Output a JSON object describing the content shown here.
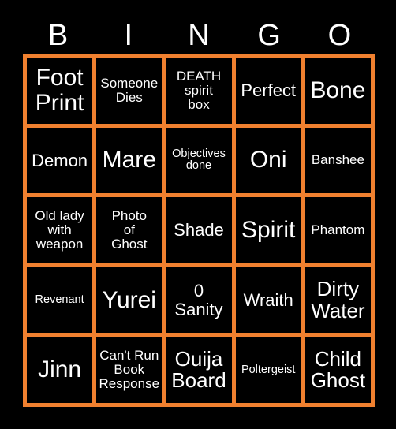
{
  "card": {
    "title": "BINGO",
    "header_letters": [
      "B",
      "I",
      "N",
      "G",
      "O"
    ],
    "colors": {
      "background": "#000000",
      "grid_border": "#F0802F",
      "cell_background": "#000000",
      "text": "#FFFFFF"
    },
    "grid": {
      "columns": 5,
      "rows": 5,
      "cells": [
        {
          "text": "Foot\nPrint",
          "size": "fs-xl",
          "marked": false
        },
        {
          "text": "Someone\nDies",
          "size": "fs-sm",
          "marked": false
        },
        {
          "text": "DEATH\nspirit\nbox",
          "size": "fs-sm",
          "marked": false
        },
        {
          "text": "Perfect",
          "size": "fs-md",
          "marked": false
        },
        {
          "text": "Bone",
          "size": "fs-xl",
          "marked": false
        },
        {
          "text": "Demon",
          "size": "fs-md",
          "marked": false
        },
        {
          "text": "Mare",
          "size": "fs-xl",
          "marked": false
        },
        {
          "text": "Objectives\ndone",
          "size": "fs-xs",
          "marked": false
        },
        {
          "text": "Oni",
          "size": "fs-xl",
          "marked": false
        },
        {
          "text": "Banshee",
          "size": "fs-sm",
          "marked": false
        },
        {
          "text": "Old lady\nwith\nweapon",
          "size": "fs-sm",
          "marked": false
        },
        {
          "text": "Photo\nof\nGhost",
          "size": "fs-sm",
          "marked": false
        },
        {
          "text": "Shade",
          "size": "fs-md",
          "marked": false
        },
        {
          "text": "Spirit",
          "size": "fs-xl",
          "marked": false
        },
        {
          "text": "Phantom",
          "size": "fs-sm",
          "marked": false
        },
        {
          "text": "Revenant",
          "size": "fs-xs",
          "marked": false
        },
        {
          "text": "Yurei",
          "size": "fs-xl",
          "marked": false
        },
        {
          "text": "0\nSanity",
          "size": "fs-md",
          "marked": false
        },
        {
          "text": "Wraith",
          "size": "fs-md",
          "marked": false
        },
        {
          "text": "Dirty\nWater",
          "size": "fs-lg",
          "marked": false
        },
        {
          "text": "Jinn",
          "size": "fs-xl",
          "marked": false
        },
        {
          "text": "Can't Run\nBook\nResponse",
          "size": "fs-sm",
          "marked": false
        },
        {
          "text": "Ouija\nBoard",
          "size": "fs-lg",
          "marked": false
        },
        {
          "text": "Poltergeist",
          "size": "fs-xs",
          "marked": false
        },
        {
          "text": "Child\nGhost",
          "size": "fs-lg",
          "marked": false
        }
      ]
    }
  }
}
